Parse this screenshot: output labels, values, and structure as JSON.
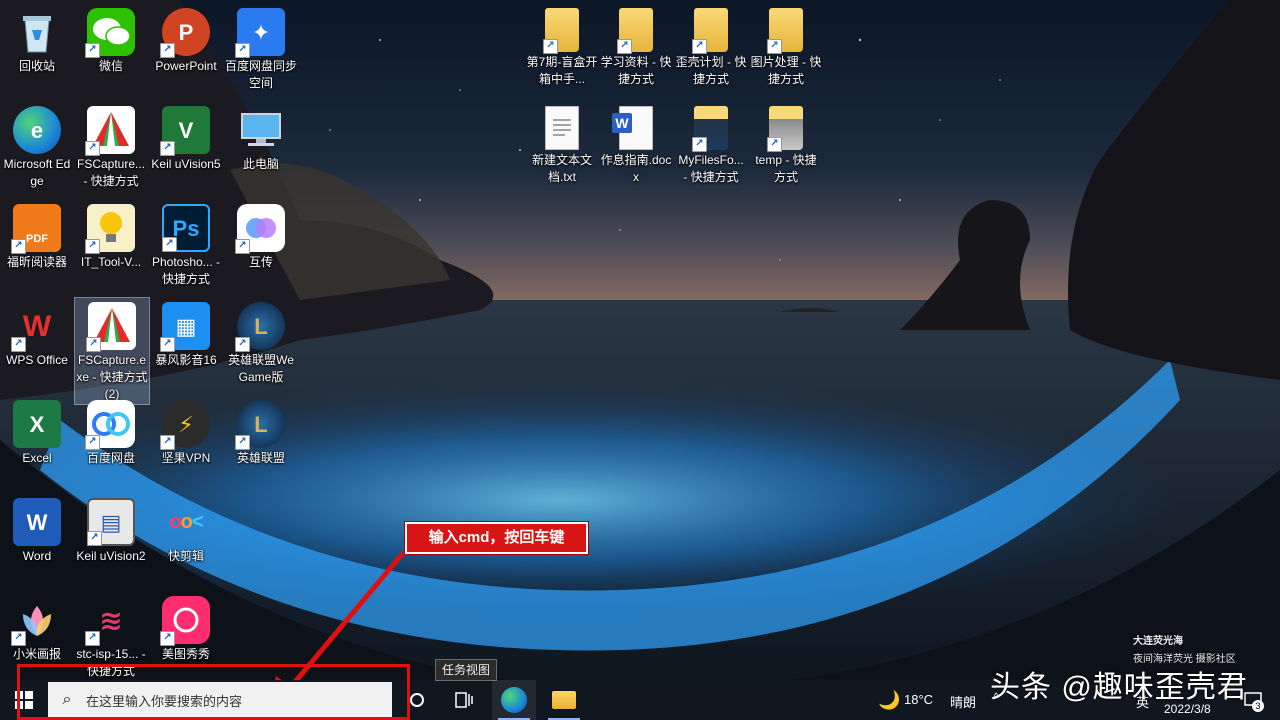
{
  "desktop_icons": [
    {
      "id": "recycle-bin",
      "label": "回收站",
      "icon": "recycle-bin-icon"
    },
    {
      "id": "wechat",
      "label": "微信",
      "icon": "wechat-icon"
    },
    {
      "id": "powerpoint",
      "label": "PowerPoint",
      "icon": "powerpoint-icon"
    },
    {
      "id": "baidu-sync",
      "label": "百度网盘同步空间",
      "icon": "baidu-sync-icon"
    },
    {
      "id": "edge",
      "label": "Microsoft Edge",
      "icon": "edge-icon"
    },
    {
      "id": "fscapture",
      "label": "FSCapture... - 快捷方式",
      "icon": "fscapture-icon"
    },
    {
      "id": "keil5",
      "label": "Keil uVision5",
      "icon": "keil-icon"
    },
    {
      "id": "this-pc",
      "label": "此电脑",
      "icon": "computer-icon"
    },
    {
      "id": "foxit",
      "label": "福昕阅读器",
      "icon": "foxit-pdf-icon"
    },
    {
      "id": "it-tool",
      "label": "IT_Tool-V...",
      "icon": "lightbulb-icon"
    },
    {
      "id": "photoshop",
      "label": "Photosho... - 快捷方式",
      "icon": "photoshop-icon"
    },
    {
      "id": "hutu",
      "label": "互传",
      "icon": "hutu-icon"
    },
    {
      "id": "wps",
      "label": "WPS Office",
      "icon": "wps-icon"
    },
    {
      "id": "fscapture2",
      "label": "FSCapture.exe - 快捷方式 (2)",
      "icon": "fscapture-icon"
    },
    {
      "id": "baofeng",
      "label": "暴风影音16",
      "icon": "baofeng-icon"
    },
    {
      "id": "lol-wegame",
      "label": "英雄联盟WeGame版",
      "icon": "lol-icon"
    },
    {
      "id": "excel",
      "label": "Excel",
      "icon": "excel-icon"
    },
    {
      "id": "baidu-pan",
      "label": "百度网盘",
      "icon": "baidu-pan-icon"
    },
    {
      "id": "jianguo-vpn",
      "label": "坚果VPN",
      "icon": "vpn-icon"
    },
    {
      "id": "lol",
      "label": "英雄联盟",
      "icon": "lol-icon"
    },
    {
      "id": "word",
      "label": "Word",
      "icon": "word-icon"
    },
    {
      "id": "keil2",
      "label": "Keil uVision2",
      "icon": "keil2-icon"
    },
    {
      "id": "kuaijian",
      "label": "快剪辑",
      "icon": "kuaijian-icon"
    },
    {
      "id": "mi-paint",
      "label": "小米画报",
      "icon": "mi-paint-icon"
    },
    {
      "id": "stc-isp",
      "label": "stc-isp-15... - 快捷方式",
      "icon": "stc-isp-icon"
    },
    {
      "id": "meitu",
      "label": "美图秀秀",
      "icon": "meitu-icon"
    },
    {
      "id": "folder-7",
      "label": "第7期-盲盒开箱中手...",
      "icon": "folder-icon"
    },
    {
      "id": "folder-study",
      "label": "学习资料 - 快捷方式",
      "icon": "folder-icon"
    },
    {
      "id": "folder-plan",
      "label": "歪壳计划 - 快捷方式",
      "icon": "folder-icon"
    },
    {
      "id": "folder-pic",
      "label": "图片处理 - 快捷方式",
      "icon": "folder-icon"
    },
    {
      "id": "txt-new",
      "label": "新建文本文档.txt",
      "icon": "text-file-icon"
    },
    {
      "id": "docx-guide",
      "label": "作息指南.docx",
      "icon": "word-doc-icon"
    },
    {
      "id": "myfiles",
      "label": "MyFilesFo... - 快捷方式",
      "icon": "folder-icon"
    },
    {
      "id": "temp",
      "label": "temp - 快捷方式",
      "icon": "folder-icon"
    }
  ],
  "annotation": {
    "callout_text": "输入cmd，按回车键",
    "highlight_color": "#e01010"
  },
  "taskbar": {
    "search_placeholder": "在这里输入你要搜索的内容",
    "task_view_tooltip": "任务视图",
    "weather_temp": "18°C",
    "weather_text": "晴朗",
    "ime": "英",
    "date": "2022/3/8",
    "notification_count": "3"
  },
  "watermark": {
    "main": "头条 @趣味歪壳君",
    "location": "大连荧光海",
    "caption": "夜间海洋荧光 摄影社区"
  }
}
